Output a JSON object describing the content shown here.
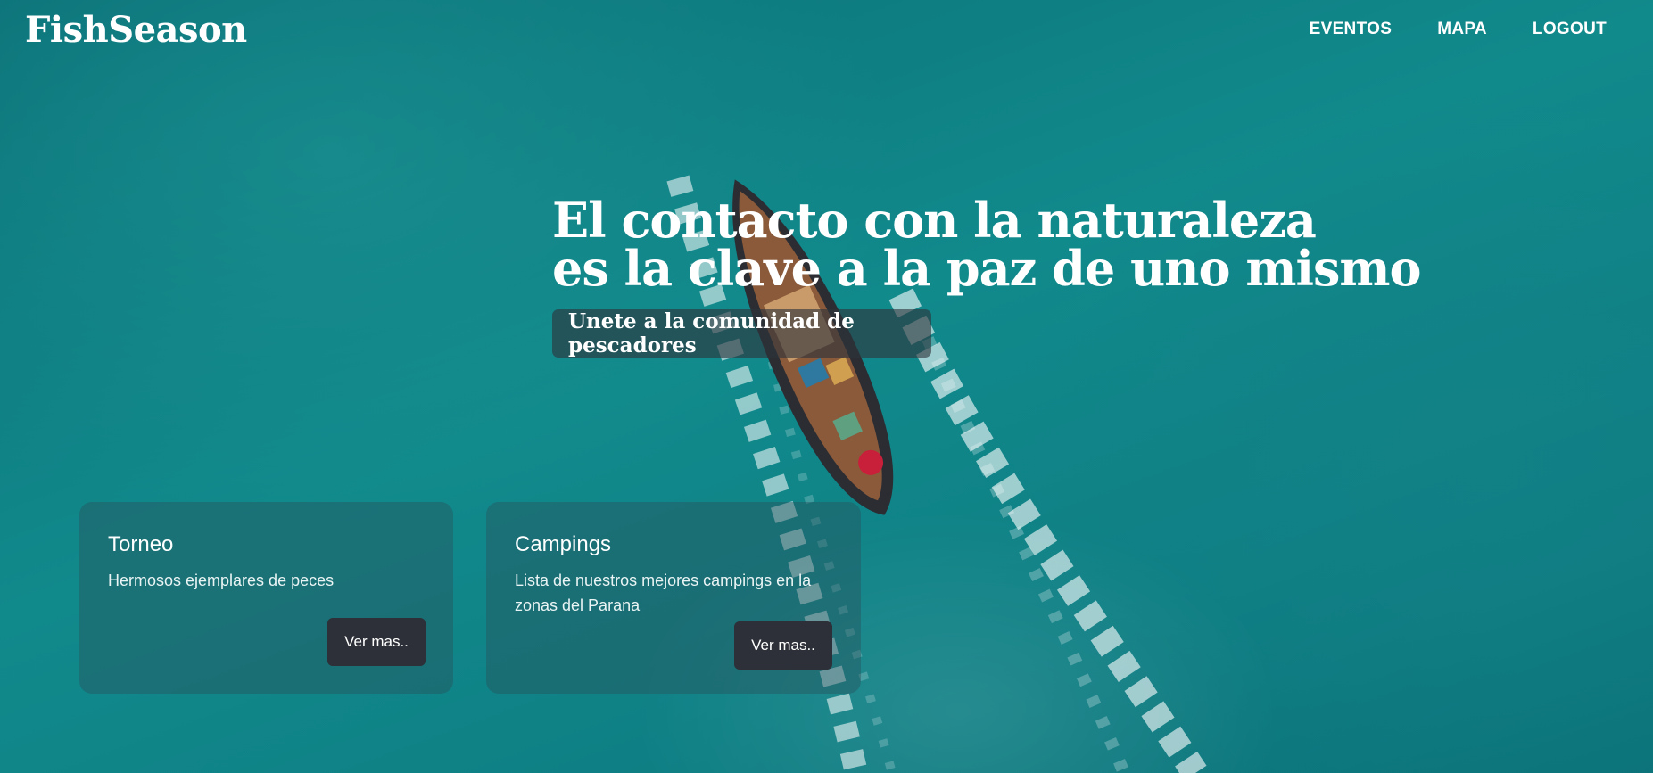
{
  "brand": {
    "name": "FishSeason"
  },
  "nav": {
    "items": [
      "EVENTOS",
      "MAPA",
      "LOGOUT"
    ]
  },
  "hero": {
    "line1": "El contacto con la naturaleza",
    "line2": "es la clave a la paz de uno mismo",
    "cta_label": "Unete a la comunidad de pescadores"
  },
  "cards": [
    {
      "title": "Torneo",
      "description": "Hermosos ejemplares de peces",
      "button_label": "Ver mas.."
    },
    {
      "title": "Campings",
      "description": "Lista de nuestros mejores campings en la zonas del Parana",
      "button_label": "Ver mas.."
    }
  ],
  "colors": {
    "sea": "#0f7f83",
    "card_button": "#2d3038",
    "text": "#ffffff"
  }
}
